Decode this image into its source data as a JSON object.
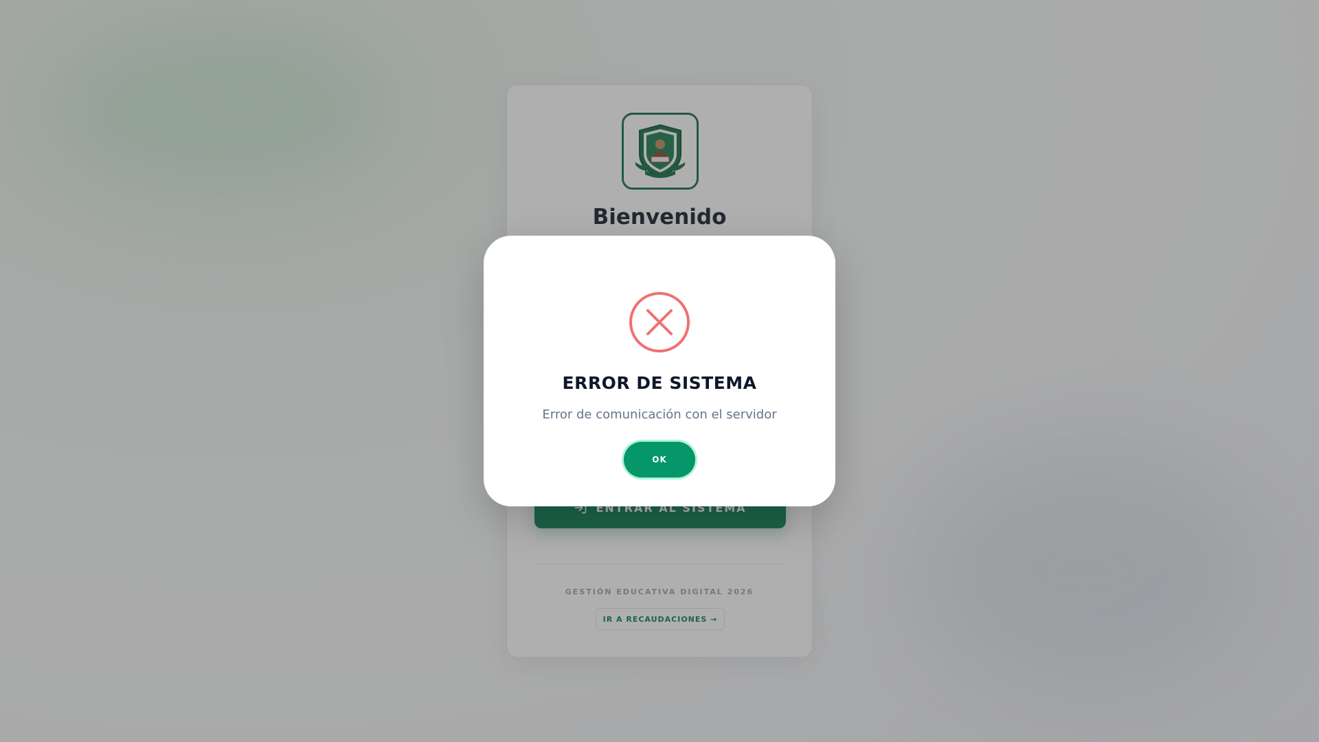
{
  "login": {
    "title": "Bienvenido",
    "enter_label": "ENTRAR AL SISTEMA",
    "footer": "GESTIÓN EDUCATIVA DIGITAL 2026",
    "recaudaciones_link": "IR A RECAUDACIONES →"
  },
  "modal": {
    "icon": "error-x-circle-icon",
    "title": "ERROR DE SISTEMA",
    "message": "Error de comunicación con el servidor",
    "ok_label": "OK"
  },
  "colors": {
    "primary_green": "#047a4f",
    "ok_green": "#059669",
    "error_red": "#f07171"
  }
}
